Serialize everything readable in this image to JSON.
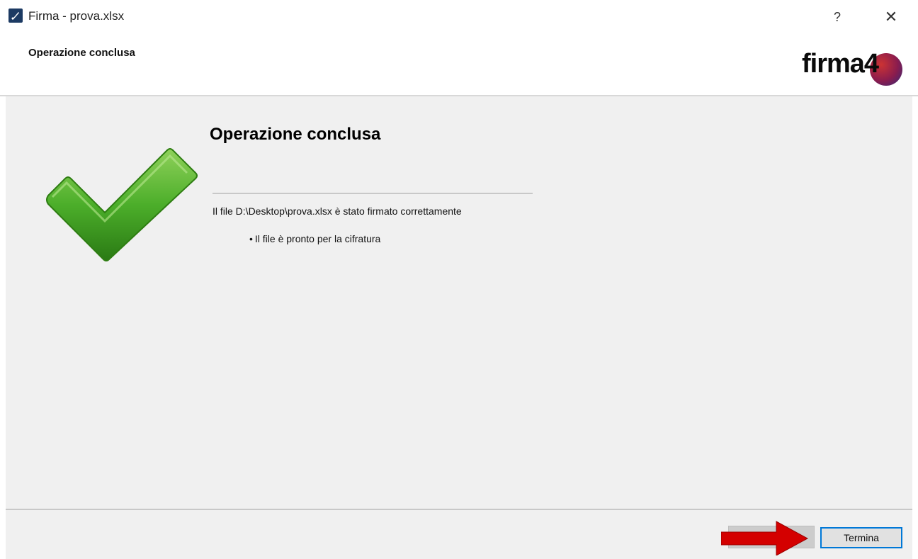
{
  "window": {
    "title": "Firma - prova.xlsx",
    "help_label": "?",
    "close_label": "✕"
  },
  "header": {
    "title": "Operazione conclusa",
    "logo_text": "firma4"
  },
  "content": {
    "title": "Operazione conclusa",
    "message": "Il file D:\\Desktop\\prova.xlsx è stato firmato correttamente",
    "bullet": "Il file è pronto per la cifratura",
    "bullet_marker": "•"
  },
  "footer": {
    "finish_label": "Termina"
  },
  "colors": {
    "check_green": "#4caf2a",
    "arrow_red": "#d40000",
    "focus_blue": "#0078d7"
  }
}
